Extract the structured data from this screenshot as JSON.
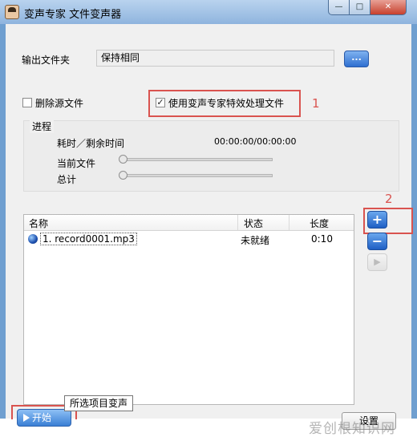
{
  "window": {
    "title": "变声专家 文件变声器",
    "min_glyph": "—",
    "max_glyph": "□",
    "close_glyph": "✕"
  },
  "output": {
    "label": "输出文件夹",
    "value": "保持相同",
    "browse_label": "..."
  },
  "options": {
    "delete_source_label": "删除源文件",
    "delete_source_checked": false,
    "use_effect_label": "使用变声专家特效处理文件",
    "use_effect_checked": true,
    "check_glyph": "✓"
  },
  "progress": {
    "group_label": "进程",
    "time_label": "耗时／剩余时间",
    "time_value": "00:00:00/00:00:00",
    "current_file_label": "当前文件",
    "total_label": "总计",
    "current_file_progress": 0,
    "total_progress": 0
  },
  "file_list": {
    "columns": [
      "名称",
      "状态",
      "长度"
    ],
    "rows": [
      {
        "name": "1. record0001.mp3",
        "status": "未就绪",
        "length": "0:10"
      }
    ]
  },
  "side_buttons": {
    "add_glyph": "+",
    "remove_glyph": "−",
    "play_glyph": "▶"
  },
  "bottom": {
    "start_label": "开始",
    "tooltip": "所选项目变声",
    "settings_label": "设置"
  },
  "annotations": {
    "marker_1": "1",
    "marker_2": "2",
    "color": "#d9534f"
  },
  "watermark": "爱创根知识网"
}
